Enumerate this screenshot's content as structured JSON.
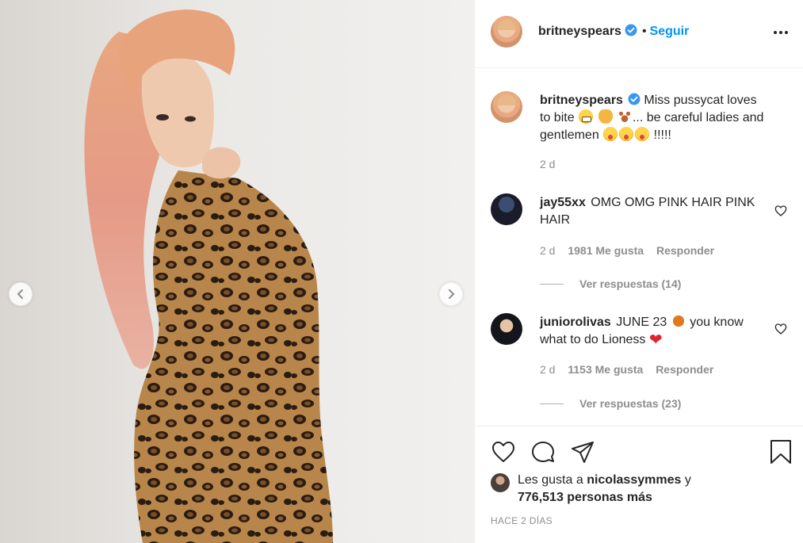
{
  "post": {
    "author": "britneyspears",
    "dot": "•",
    "follow_label": "Seguir"
  },
  "caption": {
    "username": "britneyspears",
    "text_part1": "Miss pussycat loves to bite",
    "text_part2": "... be careful ladies and gentlemen",
    "text_part3": "!!!!!",
    "time": "2 d"
  },
  "comments": [
    {
      "username": "jay55xx",
      "text": "OMG OMG PINK HAIR PINK HAIR",
      "time": "2 d",
      "likes": "1981 Me gusta",
      "reply_label": "Responder",
      "view_replies": "Ver respuestas (14)"
    },
    {
      "username": "juniorolivas",
      "text_part1": "JUNE 23",
      "text_part2": "you know what to do Lioness",
      "time": "2 d",
      "likes": "1153 Me gusta",
      "reply_label": "Responder",
      "view_replies": "Ver respuestas (23)"
    }
  ],
  "likes": {
    "prefix": "Les gusta a",
    "user": "nicolassymmes",
    "conj": "y",
    "count": "776,513 personas más"
  },
  "posted": "HACE 2 DÍAS",
  "colors": {
    "accent": "#0095f6",
    "verified": "#3897f0",
    "text": "#262626",
    "muted": "#8e8e8e"
  },
  "icons": [
    "chevron-left-icon",
    "chevron-right-icon",
    "verified-icon",
    "more-icon",
    "heart-icon",
    "comment-icon",
    "share-icon",
    "bookmark-icon"
  ]
}
